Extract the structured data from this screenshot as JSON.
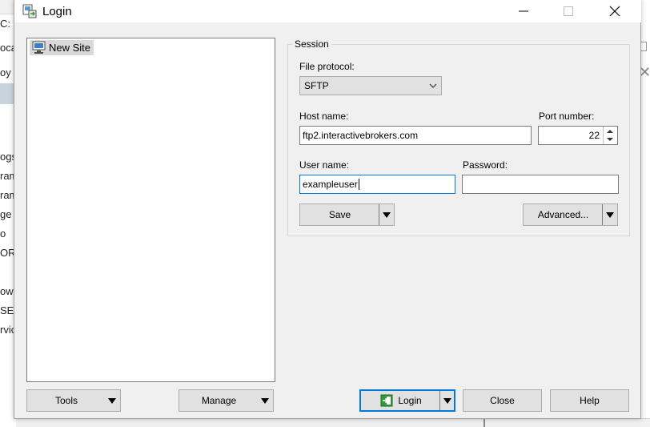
{
  "background_app": {
    "fragments": [
      "C:",
      "oca",
      "oy",
      "ogs",
      "ram",
      "ram",
      "ge",
      "o",
      "ORM",
      "ow",
      "SEI",
      "rvic"
    ]
  },
  "window": {
    "title": "Login",
    "minimize_symbol": "—",
    "maximize_symbol": "☐",
    "close_symbol": "✕"
  },
  "site_tree": {
    "items": [
      {
        "label": "New Site",
        "icon": "computer-site-icon",
        "selected": true
      }
    ]
  },
  "session": {
    "group_label": "Session",
    "protocol_label": "File protocol:",
    "protocol_value": "SFTP",
    "host_label": "Host name:",
    "host_value": "ftp2.interactivebrokers.com",
    "port_label": "Port number:",
    "port_value": "22",
    "user_label": "User name:",
    "user_value": "exampleuser",
    "password_label": "Password:",
    "password_value": "",
    "save_label": "Save",
    "advanced_label": "Advanced..."
  },
  "footer": {
    "tools_label": "Tools",
    "manage_label": "Manage",
    "login_label": "Login",
    "close_label": "Close",
    "help_label": "Help"
  },
  "colors": {
    "accent": "#0078d7",
    "button_bg": "#e1e1e1",
    "dialog_bg": "#f0f0f0",
    "login_icon_green": "#2e9a3b"
  }
}
